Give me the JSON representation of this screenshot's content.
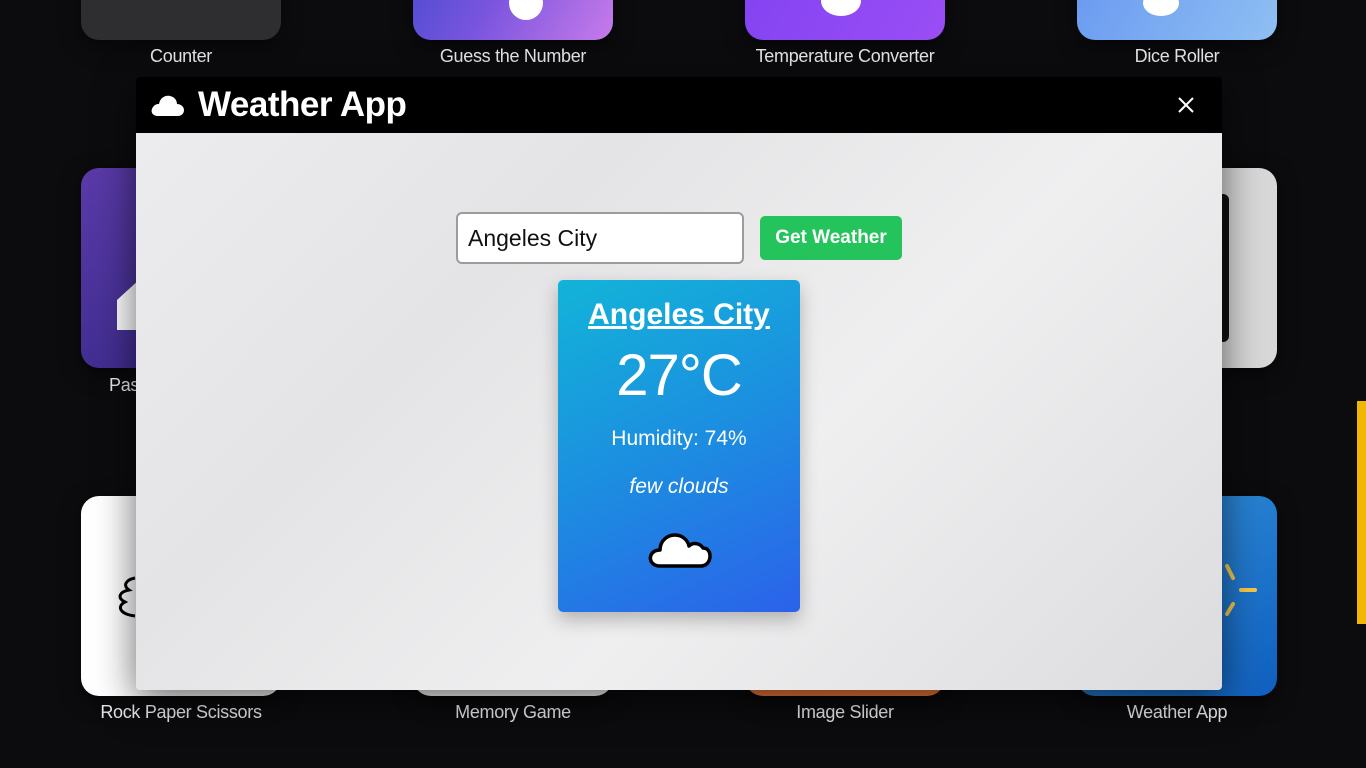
{
  "background_apps": [
    {
      "id": "counter",
      "label": "Counter"
    },
    {
      "id": "guess",
      "label": "Guess the Number"
    },
    {
      "id": "temp",
      "label": "Temperature Converter"
    },
    {
      "id": "dice",
      "label": "Dice Roller"
    },
    {
      "id": "password",
      "label": "Pas"
    },
    {
      "id": "rps",
      "label": "Rock Paper Scissors"
    },
    {
      "id": "memory",
      "label": "Memory Game"
    },
    {
      "id": "slider",
      "label": "Image Slider"
    },
    {
      "id": "weather",
      "label": "Weather App"
    }
  ],
  "modal": {
    "title": "Weather App",
    "title_icon": "cloud-icon",
    "close_icon": "close-icon"
  },
  "search": {
    "value": "Angeles City",
    "button_label": "Get Weather"
  },
  "weather": {
    "city": "Angeles City",
    "temperature": "27°C",
    "humidity": "Humidity: 74%",
    "description": "few clouds",
    "icon": "cloud-outline-icon"
  },
  "colors": {
    "accent_green": "#25c35c",
    "card_gradient_start": "#12b4d8",
    "card_gradient_end": "#2b62ea"
  }
}
